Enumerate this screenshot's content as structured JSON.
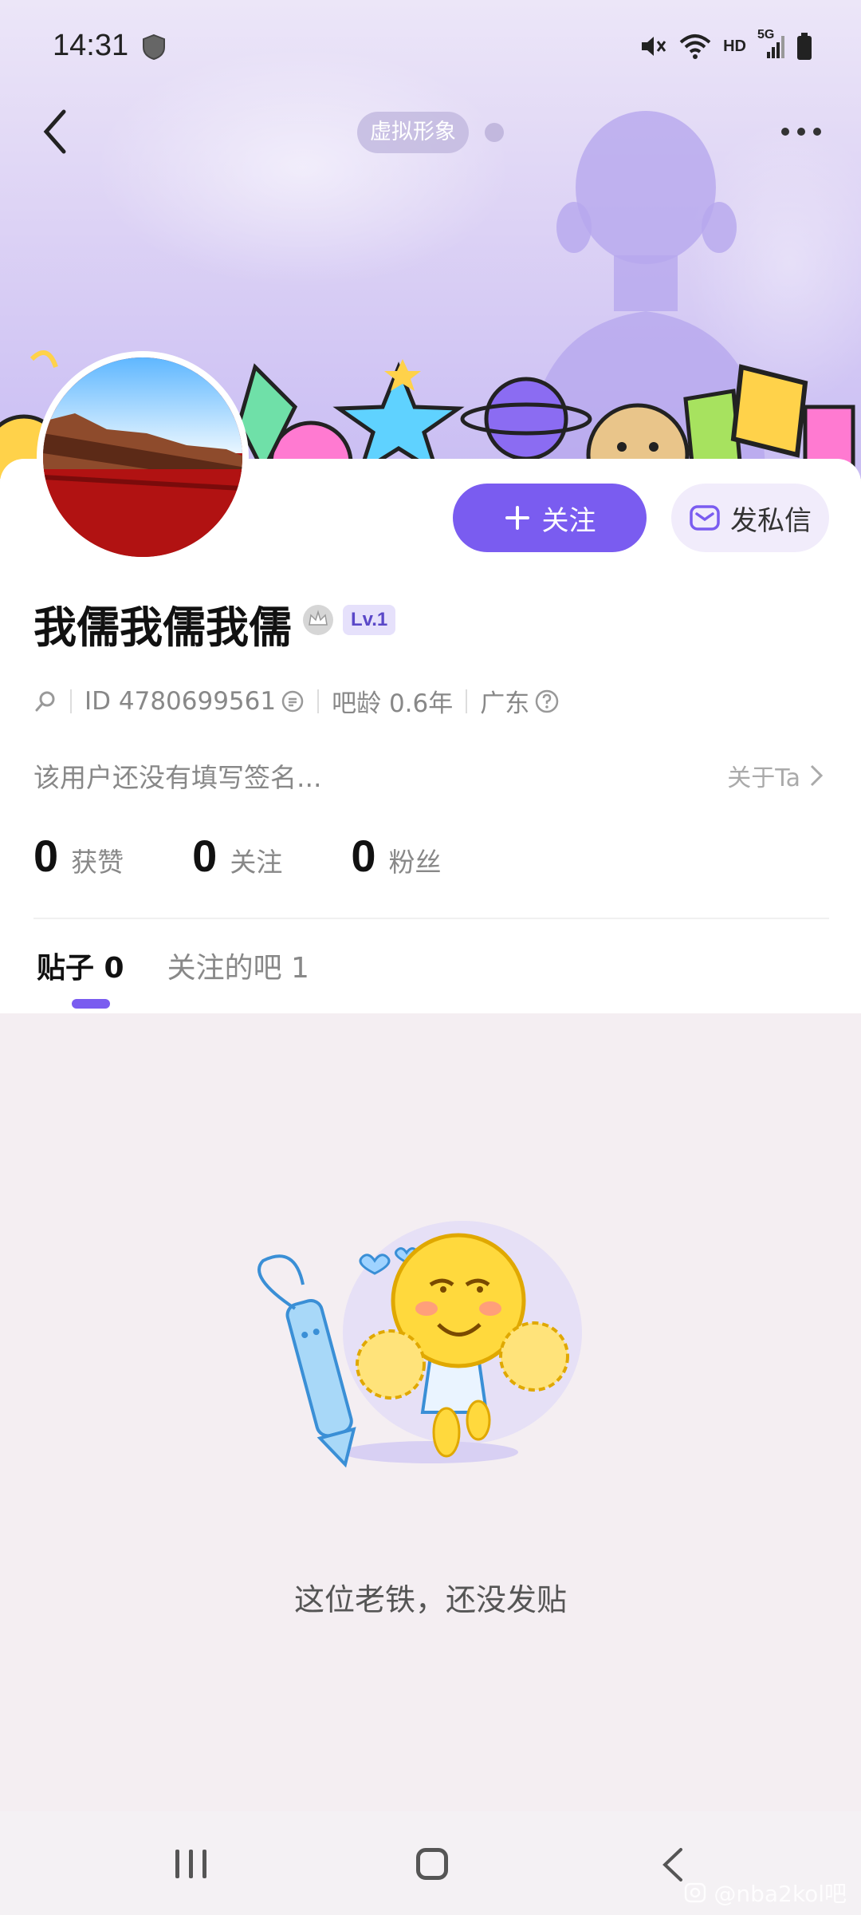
{
  "status_bar": {
    "time": "14:31",
    "network": "HD",
    "signal": "5G"
  },
  "header": {
    "avatar_pill_label": "虚拟形象"
  },
  "profile": {
    "username": "我儒我儒我儒",
    "level": "Lv.1",
    "id_text": "ID 4780699561",
    "age_text": "吧龄 0.6年",
    "location": "广东",
    "bio": "该用户还没有填写签名...",
    "about_label": "关于Ta",
    "follow_label": "关注",
    "dm_label": "发私信"
  },
  "stats": [
    {
      "value": "0",
      "label": "获赞"
    },
    {
      "value": "0",
      "label": "关注"
    },
    {
      "value": "0",
      "label": "粉丝"
    }
  ],
  "tabs": [
    {
      "label": "贴子 0",
      "active": true
    },
    {
      "label": "关注的吧 1",
      "active": false
    }
  ],
  "empty_state": {
    "message": "这位老铁，还没发贴"
  },
  "watermark": "@nba2kol吧",
  "colors": {
    "accent": "#7a5cf0",
    "banner": "#d8cff5"
  }
}
